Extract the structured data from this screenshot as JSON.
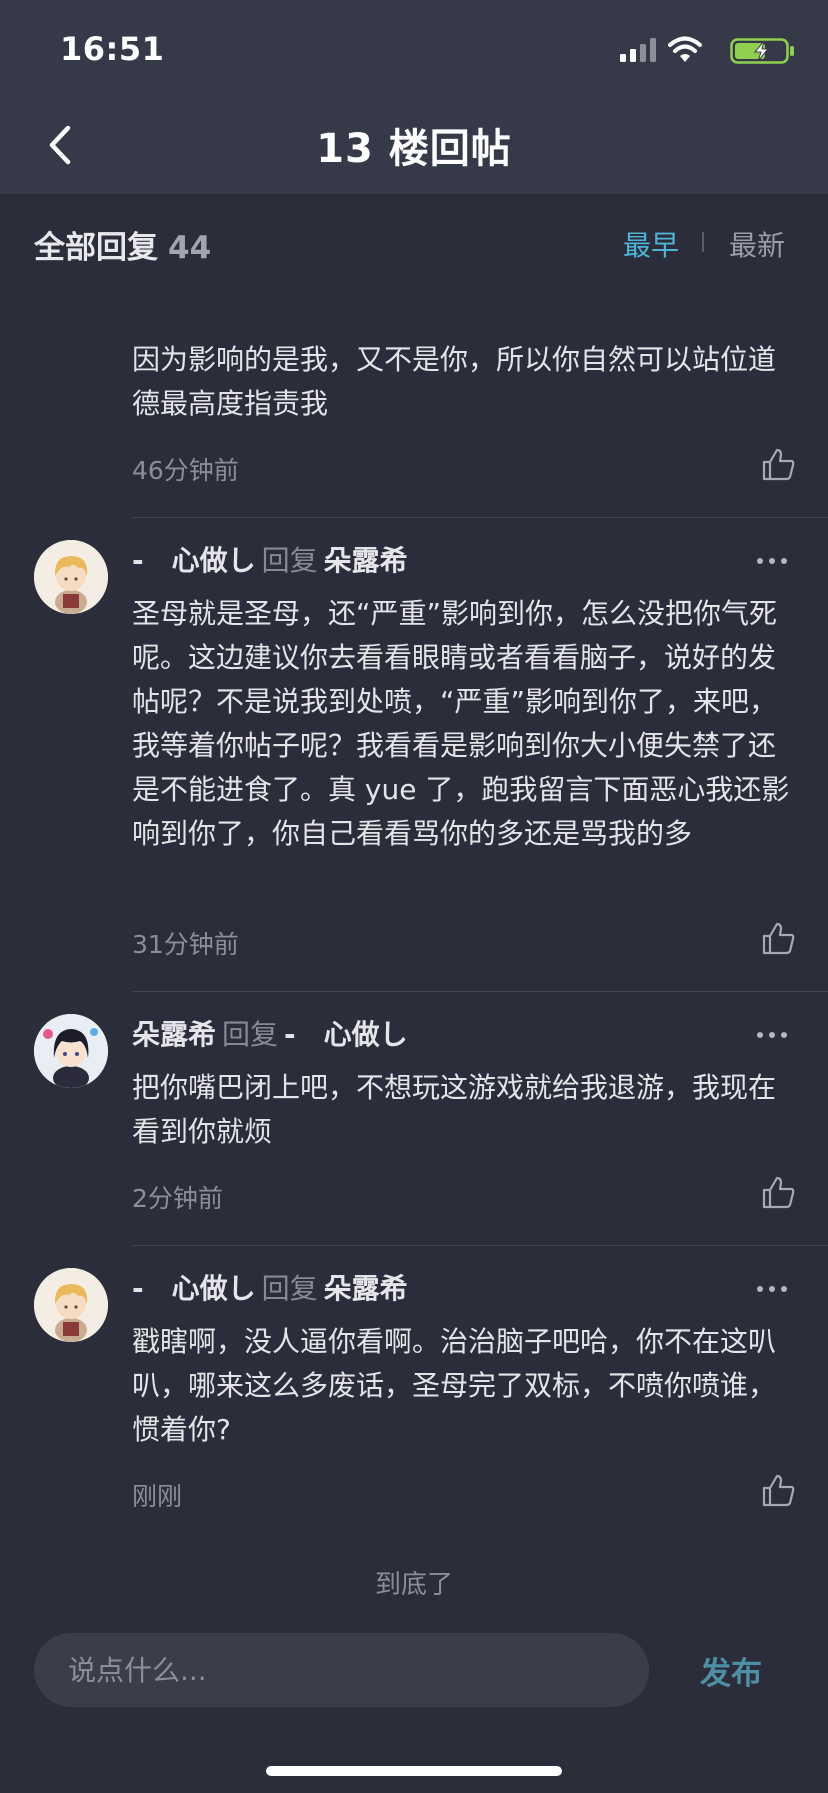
{
  "status_bar": {
    "time": "16:51",
    "icons": [
      "cellular-signal-icon",
      "wifi-icon",
      "battery-charging-icon"
    ]
  },
  "nav": {
    "back_icon": "chevron-left-icon",
    "title": "13 楼回帖"
  },
  "replies_header": {
    "title": "全部回复",
    "count": "44",
    "sort_options": [
      "最早",
      "最新"
    ],
    "active_sort": "最早"
  },
  "comments": [
    {
      "has_header": false,
      "text": "因为影响的是我，又不是你，所以你自然可以站位道德最高度指责我",
      "time": "46分钟前"
    },
    {
      "has_header": true,
      "author": "-　心做し",
      "reply_word": "回复",
      "target": "朵露希",
      "avatar": "blonde-anime-character-avatar",
      "text": "圣母就是圣母，还“严重”影响到你，怎么没把你气死呢。这边建议你去看看眼睛或者看看脑子，说好的发帖呢？不是说我到处喷，“严重”影响到你了，来吧，我等着你帖子呢？我看看是影响到你大小便失禁了还是不能进食了。真 yue 了，跑我留言下面恶心我还影响到你了，你自己看看骂你的多还是骂我的多",
      "time": "31分钟前"
    },
    {
      "has_header": true,
      "author": "朵露希",
      "reply_word": "回复",
      "target": "-　心做し",
      "avatar": "dark-haired-anime-character-avatar",
      "text": "把你嘴巴闭上吧，不想玩这游戏就给我退游，我现在看到你就烦",
      "time": "2分钟前"
    },
    {
      "has_header": true,
      "author": "-　心做し",
      "reply_word": "回复",
      "target": "朵露希",
      "avatar": "blonde-anime-character-avatar",
      "text": "戳瞎啊，没人逼你看啊。治治脑子吧哈，你不在这叭叭，哪来这么多废话，圣母完了双标，不喷你喷谁，惯着你?",
      "time": "刚刚"
    }
  ],
  "footer": {
    "end_text": "到底了",
    "input_placeholder": "说点什么...",
    "publish_label": "发布"
  },
  "colors": {
    "background": "#2b2e3a",
    "nav_background": "#363a48",
    "accent": "#4fb3d6",
    "publish": "#4f8fa6",
    "muted_text": "#8b8e98"
  }
}
